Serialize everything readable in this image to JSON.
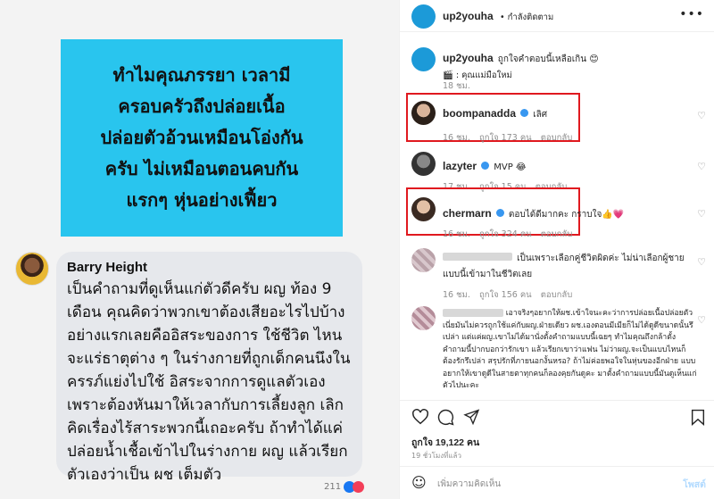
{
  "left": {
    "question": "ทำไมคุณภรรยา เวลามี\nครอบครัวถึงปล่อยเนื้อ\nปล่อยตัวอ้วนเหมือนโอ่งกัน\nครับ ไม่เหมือนตอนคบกัน\nแรกๆ หุ่นอย่างเฟี้ยว",
    "reply_author": "Barry Height",
    "reply_text": "เป็นคำถามที่ดูเห็นแก่ตัวดีครับ ผญ ท้อง 9 เดือน คุณคิดว่าพวกเขาต้องเสียอะไรไปบ้าง อย่างแรกเลยคืออิสระของการ ใช้ชีวิต ไหนจะแร่ธาตุต่าง ๆ ในร่างกายที่ถูกเด็กคนนึงใน ครรภ์แย่งไปใช้ อิสระจากการดูแลตัวเอง เพราะต้องหันมาให้เวลากับการเลี้ยงลูก เลิกคิดเรื่องไร้สาระพวกนี้เถอะครับ ถ้าทำได้แค่ ปล่อยน้ำเชื้อเข้าไปในร่างกาย ผญ แล้วเรียก ตัวเองว่าเป็น ผช เต็มตัว",
    "reaction_count": "211"
  },
  "post": {
    "username": "up2youha",
    "follow_status": "• กำลังติดตาม",
    "caption_user": "up2youha",
    "caption_text": "ถูกใจคำตอบนี้เหลือเกิน 😊",
    "caption_sub": "🎬 : คุณแม่มือใหม่",
    "caption_time": "18 ชม.",
    "comments": [
      {
        "user": "boompanadda",
        "verified": true,
        "text": "เลิศ",
        "time": "16 ชม.",
        "likes": "ถูกใจ 173 คน",
        "reply": "ตอบกลับ"
      },
      {
        "user": "lazyter",
        "verified": true,
        "text": "MVP 😂",
        "time": "17 ชม.",
        "likes": "ถูกใจ 15 คน",
        "reply": "ตอบกลับ"
      },
      {
        "user": "chermarn",
        "verified": true,
        "text": "ตอบได้ดีมากคะ กราบใจ👍💗",
        "time": "16 ชม.",
        "likes": "ถูกใจ 324 คน",
        "reply": "ตอบกลับ"
      },
      {
        "user": "",
        "verified": false,
        "text": "เป็นเพราะเลือกคู่ชีวิตผิดค่ะ ไม่น่าเลือกผู้ชายแบบนี้เข้ามาในชีวิตเลย",
        "time": "16 ชม.",
        "likes": "ถูกใจ 156 คน",
        "reply": "ตอบกลับ"
      },
      {
        "user": "",
        "verified": false,
        "text": "เอาจริงๆอยากให้ผช.เข้าใจนะคะว่าการปล่อยเนื้อปล่อยตัวเนี่ยมันไม่ควรถูกใช้แค่กับผญ.ฝ่ายเดียว ผช.เองตอนมีเมียก็ไม่ได้ดูดีขนาดนั้นรึเปล่า แต่แค่ผญ.เขาไม่ได้มานั่งตั้งคำถามแบบนี้เฉยๆ ทำไมคุณถึงกล้าตั้งคำถามนี้ปากบอกว่ารักเขา แล้วเรียกเขาว่าแฟน ไม่ว่าผญ.จะเป็นแบบไหนก็ต้องรักรึเปล่า สรุปรักที่ภายนอกงั้นหรอ? ถ้าไม่ค่อยพอใจในหุ่นของอีกฝ่าย แบบอยากให้เขาดูดีในสายตาทุกคนก็ลองคุยกันดูคะ มาตั้งคำถามแบบนี้มันดูเห็นแก่ตัวไปนะคะ",
        "time": "",
        "likes": "",
        "reply": ""
      }
    ],
    "like_count": "ถูกใจ 19,122 คน",
    "post_time": "19 ชั่วโมงที่แล้ว",
    "comment_placeholder": "เพิ่มความคิดเห็น",
    "post_button": "โพสต์"
  },
  "colors": {
    "highlight": "#e0191f",
    "verified": "#3897f0",
    "question_bg": "#29c5ee",
    "post_btn": "#b3dbff"
  }
}
